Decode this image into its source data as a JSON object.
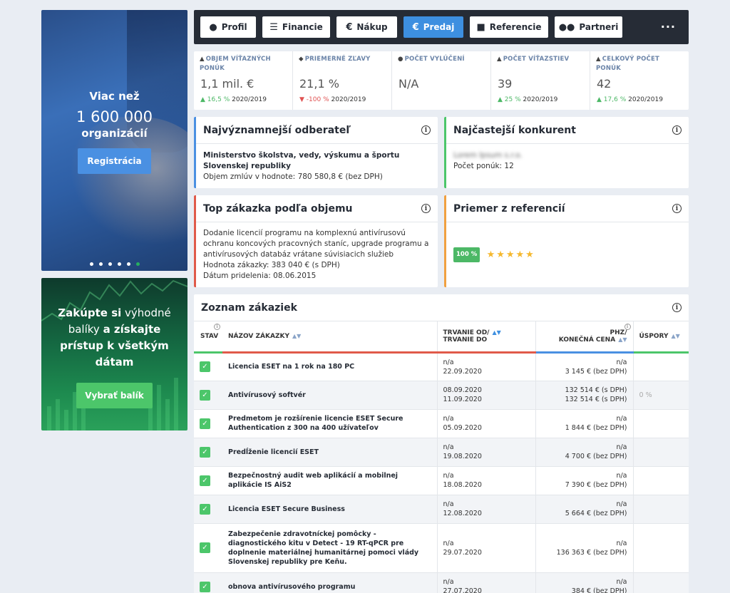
{
  "promo1": {
    "line1": "Viac než",
    "count": "1 600 000",
    "line3": "organizácií",
    "button": "Registrácia"
  },
  "promo2": {
    "part1": "Zakúpte si",
    "part2": " výhodné balíky ",
    "part3": "a získajte prístup k všetkým dátam",
    "button": "Vybrať balík"
  },
  "nav": {
    "items": [
      {
        "label": "Profil",
        "icon": "user-icon"
      },
      {
        "label": "Financie",
        "icon": "database-icon"
      },
      {
        "label": "Nákup",
        "icon": "euro-icon"
      },
      {
        "label": "Predaj",
        "icon": "euro-icon"
      },
      {
        "label": "Referencie",
        "icon": "briefcase-icon"
      },
      {
        "label": "Partneri",
        "icon": "users-icon"
      }
    ],
    "active": "Predaj",
    "more": "···"
  },
  "stats": [
    {
      "label": "OBJEM VÍŤAZNÝCH PONÚK",
      "value": "1,1 mil. €",
      "change": "16,5 %",
      "period": "2020/2019",
      "dir": "up"
    },
    {
      "label": "PRIEMERNÉ ZĽAVY",
      "value": "21,1 %",
      "change": "-100 %",
      "period": "2020/2019",
      "dir": "down"
    },
    {
      "label": "POČET VYLÚČENÍ",
      "value": "N/A",
      "change": "",
      "period": "",
      "dir": ""
    },
    {
      "label": "POČET VÍŤAZSTIEV",
      "value": "39",
      "change": "25 %",
      "period": "2020/2019",
      "dir": "up"
    },
    {
      "label": "CELKOVÝ POČET PONÚK",
      "value": "42",
      "change": "17,6 %",
      "period": "2020/2019",
      "dir": "up"
    }
  ],
  "cards": {
    "customer": {
      "title": "Najvýznamnejší odberateľ",
      "name": "Ministerstvo školstva, vedy, výskumu a športu Slovenskej republiky",
      "detail": "Objem zmlúv v hodnote: 780 580,8 € (bez DPH)"
    },
    "competitor": {
      "title": "Najčastejší konkurent",
      "name": "Lorem Ipsum s.r.o.",
      "detail": "Počet ponúk: 12"
    },
    "top": {
      "title": "Top zákazka podľa objemu",
      "desc": "Dodanie licencií programu na komplexnú antivírusovú ochranu koncových pracovných staníc, upgrade programu a antivírusových databáz vrátane súvisiacich služieb",
      "value": "Hodnota zákazky: 383 040 € (s DPH)",
      "date": "Dátum pridelenia: 08.06.2015"
    },
    "rating": {
      "title": "Priemer z referencií",
      "percent": "100 %",
      "stars": "★★★★★",
      "stars_value": 5
    }
  },
  "table": {
    "title": "Zoznam zákaziek",
    "headers": {
      "stav": "STAV",
      "name": "NÁZOV ZÁKAZKY",
      "dur1": "TRVANIE OD/",
      "dur2": "TRVANIE DO",
      "cena1": "PHZ/",
      "cena2": "KONEČNÁ CENA",
      "usp": "ÚSPORY"
    },
    "rows": [
      {
        "name": "Licencia ESET na 1 rok na 180 PC",
        "from": "n/a",
        "to": "22.09.2020",
        "phz": "n/a",
        "cena": "3 145 € (bez DPH)",
        "usp": ""
      },
      {
        "name": "Antivírusový softvér",
        "from": "08.09.2020",
        "to": "11.09.2020",
        "phz": "132 514 € (s DPH)",
        "cena": "132 514 € (s DPH)",
        "usp": "0 %"
      },
      {
        "name": "Predmetom je rozšírenie licencie ESET Secure Authentication z 300 na 400 užívateľov",
        "from": "n/a",
        "to": "05.09.2020",
        "phz": "n/a",
        "cena": "1 844 € (bez DPH)",
        "usp": ""
      },
      {
        "name": "Predĺženie licencií ESET",
        "from": "n/a",
        "to": "19.08.2020",
        "phz": "n/a",
        "cena": "4 700 € (bez DPH)",
        "usp": ""
      },
      {
        "name": "Bezpečnostný audit web aplikácií a mobilnej aplikácie IS AiS2",
        "from": "n/a",
        "to": "18.08.2020",
        "phz": "n/a",
        "cena": "7 390 € (bez DPH)",
        "usp": ""
      },
      {
        "name": "Licencia ESET Secure Business",
        "from": "n/a",
        "to": "12.08.2020",
        "phz": "n/a",
        "cena": "5 664 € (bez DPH)",
        "usp": ""
      },
      {
        "name": "Zabezpečenie zdravotníckej pomôcky - diagnostického kitu v Detect - 19 RT-qPCR pre doplnenie materiálnej humanitárnej pomoci vlády Slovenskej republiky pre Keňu.",
        "from": "n/a",
        "to": "29.07.2020",
        "phz": "n/a",
        "cena": "136 363 € (bez DPH)",
        "usp": ""
      },
      {
        "name": "obnova antivírusového programu",
        "from": "n/a",
        "to": "27.07.2020",
        "phz": "n/a",
        "cena": "384 € (bez DPH)",
        "usp": ""
      }
    ]
  }
}
